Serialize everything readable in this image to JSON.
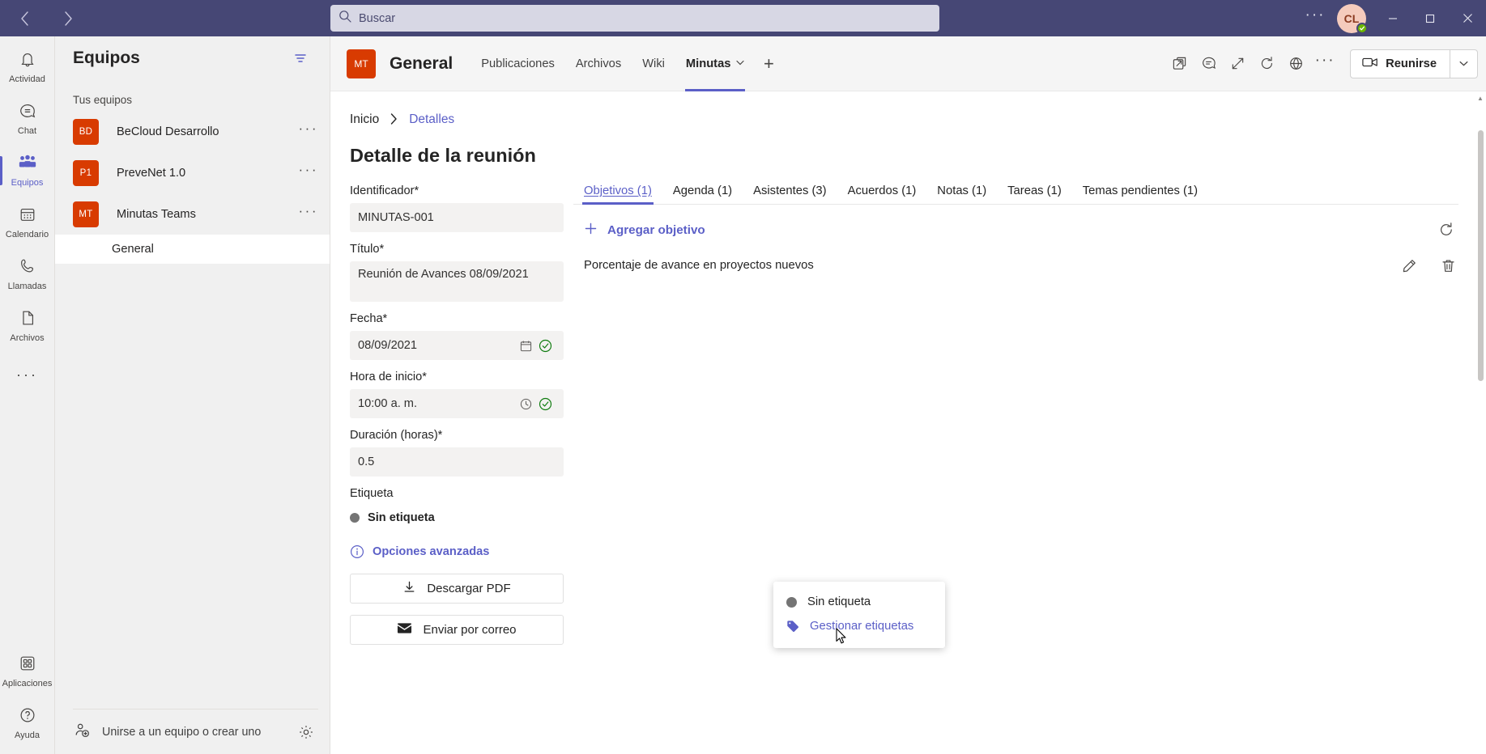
{
  "titlebar": {
    "back_icon": "chevron-left-icon",
    "forward_icon": "chevron-right-icon",
    "search_placeholder": "Buscar",
    "more_label": "···",
    "avatar_initials": "CL",
    "presence": "available",
    "minimize_label": "Minimizar",
    "maximize_label": "Maximizar",
    "close_label": "Cerrar"
  },
  "rail": {
    "items": [
      {
        "label": "Actividad",
        "icon": "bell-icon",
        "active": false
      },
      {
        "label": "Chat",
        "icon": "chat-icon",
        "active": false
      },
      {
        "label": "Equipos",
        "icon": "teams-icon",
        "active": true
      },
      {
        "label": "Calendario",
        "icon": "calendar-icon",
        "active": false
      },
      {
        "label": "Llamadas",
        "icon": "phone-icon",
        "active": false
      },
      {
        "label": "Archivos",
        "icon": "file-icon",
        "active": false
      }
    ],
    "more_label": "···",
    "bottom": [
      {
        "label": "Aplicaciones",
        "icon": "apps-grid-icon"
      },
      {
        "label": "Ayuda",
        "icon": "help-circle-icon"
      }
    ]
  },
  "teams_panel": {
    "title": "Equipos",
    "filter_icon": "filter-icon",
    "section_label": "Tus equipos",
    "teams": [
      {
        "initials": "BD",
        "name": "BeCloud Desarrollo",
        "color": "#d83b01"
      },
      {
        "initials": "P1",
        "name": "PreveNet 1.0",
        "color": "#d83b01"
      },
      {
        "initials": "MT",
        "name": "Minutas Teams",
        "color": "#d83b01"
      }
    ],
    "row_more_label": "···",
    "channel": {
      "name": "General",
      "active": true
    },
    "join_label": "Unirse a un equipo o crear uno",
    "join_icon": "add-person-icon",
    "settings_icon": "gear-icon"
  },
  "channel_header": {
    "team_initials": "MT",
    "channel_title": "General",
    "tabs": [
      {
        "label": "Publicaciones",
        "active": false,
        "caret": false
      },
      {
        "label": "Archivos",
        "active": false,
        "caret": false
      },
      {
        "label": "Wiki",
        "active": false,
        "caret": false
      },
      {
        "label": "Minutas",
        "active": true,
        "caret": true
      }
    ],
    "add_tab_label": "+",
    "icons": [
      {
        "name": "open-in-new-window-icon"
      },
      {
        "name": "conversation-icon"
      },
      {
        "name": "expand-diagonal-icon"
      },
      {
        "name": "refresh-icon"
      },
      {
        "name": "globe-icon"
      }
    ],
    "more_label": "···",
    "meet_label": "Reunirse",
    "meet_icon": "video-camera-icon",
    "meet_caret": "chevron-down-icon"
  },
  "page": {
    "breadcrumb": [
      {
        "label": "Inicio",
        "link": false
      },
      {
        "label": "Detalles",
        "link": true
      }
    ],
    "breadcrumb_sep": "›",
    "title": "Detalle de la reunión"
  },
  "form": {
    "fields": [
      {
        "label": "Identificador*",
        "value": "MINUTAS-001",
        "type": "text",
        "icon": null,
        "valid": false
      },
      {
        "label": "Título*",
        "value": "Reunión  de Avances 08/09/2021",
        "type": "textarea",
        "icon": null,
        "valid": false
      },
      {
        "label": "Fecha*",
        "value": "08/09/2021",
        "type": "date",
        "icon": "calendar-icon",
        "valid": true
      },
      {
        "label": "Hora de inicio*",
        "value": "10:00  a. m.",
        "type": "time",
        "icon": "clock-icon",
        "valid": true
      },
      {
        "label": "Duración (horas)*",
        "value": "0.5",
        "type": "text",
        "icon": null,
        "valid": false
      }
    ],
    "tag_label": "Etiqueta",
    "tag_value": "Sin etiqueta",
    "advanced_label": "Opciones avanzadas",
    "advanced_icon": "info-circle-icon",
    "buttons": [
      {
        "label": "Descargar PDF",
        "icon": "download-icon"
      },
      {
        "label": "Enviar por correo",
        "icon": "mail-icon"
      }
    ]
  },
  "detail_tabs": {
    "items": [
      {
        "label": "Objetivos (1)",
        "active": true
      },
      {
        "label": "Agenda (1)",
        "active": false
      },
      {
        "label": "Asistentes (3)",
        "active": false
      },
      {
        "label": "Acuerdos (1)",
        "active": false
      },
      {
        "label": "Notas (1)",
        "active": false
      },
      {
        "label": "Tareas (1)",
        "active": false
      },
      {
        "label": "Temas pendientes (1)",
        "active": false
      }
    ],
    "add_label": "Agregar objetivo",
    "add_icon": "plus-icon",
    "refresh_icon": "refresh-icon",
    "rows": [
      {
        "text": "Porcentaje de avance en proyectos nuevos",
        "edit_icon": "pencil-icon",
        "delete_icon": "trash-icon"
      }
    ]
  },
  "tag_popup": {
    "items": [
      {
        "label": "Sin etiqueta",
        "icon": "gray-dot-icon",
        "link": false
      },
      {
        "label": "Gestionar etiquetas",
        "icon": "tag-icon",
        "link": true
      }
    ]
  },
  "colors": {
    "brand_purple": "#464775",
    "accent": "#5b5fc7",
    "team_orange": "#d83b01",
    "ok_green": "#107c10",
    "presence_green": "#6bb700"
  }
}
